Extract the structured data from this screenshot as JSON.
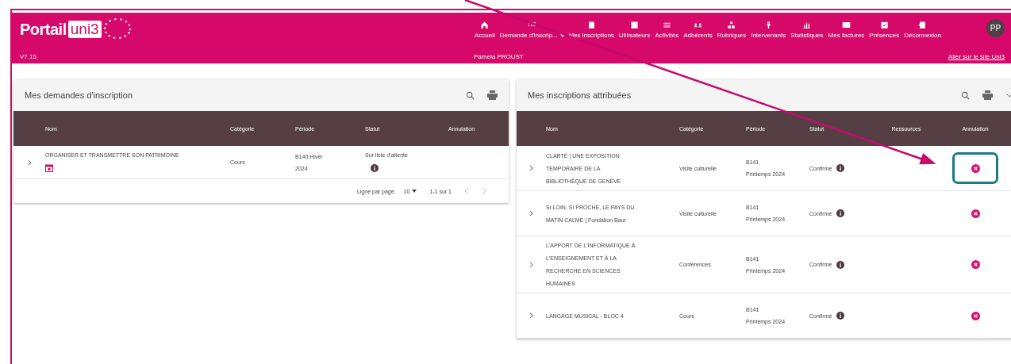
{
  "header": {
    "logo_word": "Portail",
    "logo_badge": "uni3",
    "version": "V7.15",
    "user_name": "Pamela PROUST",
    "site_link": "Aller sur le site Uni3",
    "avatar": "PP",
    "nav": [
      {
        "label": "Accueil",
        "dropdown": false
      },
      {
        "label": "Demande d'inscrip...",
        "dropdown": true
      },
      {
        "label": "Mes inscriptions",
        "dropdown": false
      },
      {
        "label": "Utilisateurs",
        "dropdown": false
      },
      {
        "label": "Activités",
        "dropdown": false
      },
      {
        "label": "Adhérents",
        "dropdown": false
      },
      {
        "label": "Rubriques",
        "dropdown": false
      },
      {
        "label": "Intervenants",
        "dropdown": false
      },
      {
        "label": "Statistiques",
        "dropdown": false
      },
      {
        "label": "Mes factures",
        "dropdown": false
      },
      {
        "label": "Présences",
        "dropdown": false
      },
      {
        "label": "Déconnexion",
        "dropdown": false
      }
    ]
  },
  "requests": {
    "title": "Mes demandes d'inscription",
    "columns": [
      "Nom",
      "Catégorie",
      "Période",
      "Statut",
      "Annulation"
    ],
    "rows": [
      {
        "name": "ORGANISER ET TRANSMETTRE SON PATRIMOINE",
        "category": "Cours",
        "period": [
          "B140 Hiver",
          "2024"
        ],
        "status": "Sur liste d'attente"
      }
    ],
    "footer": {
      "rows_label": "Ligne par page:",
      "rows_value": "10",
      "range": "1-1 sur 1"
    }
  },
  "attributed": {
    "title": "Mes inscriptions attribuées",
    "columns": [
      "Nom",
      "Catégorie",
      "Période",
      "Statut",
      "Ressources",
      "Annulation"
    ],
    "rows": [
      {
        "name": [
          "CLARTÉ | UNE EXPOSITION",
          "TEMPORAIRE DE LA",
          "BIBLIOTHÈQUE DE GENÈVE"
        ],
        "category": "Visite culturelle",
        "period": [
          "B141",
          "Printemps 2024"
        ],
        "status": "Confirmé",
        "highlighted": true
      },
      {
        "name": [
          "SI LOIN, SI PROCHE, LE PAYS DU",
          "MATIN CALME | Fondation Baur"
        ],
        "category": "Visite culturelle",
        "period": [
          "B141",
          "Printemps 2024"
        ],
        "status": "Confirmé",
        "highlighted": false
      },
      {
        "name": [
          "L'APPORT DE L'INFORMATIQUE À",
          "L'ENSEIGNEMENT ET À LA",
          "RECHERCHE EN SCIENCES",
          "HUMAINES"
        ],
        "category": "Conférences",
        "period": [
          "B141",
          "Printemps 2024"
        ],
        "status": "Confirmé",
        "highlighted": false
      },
      {
        "name": [
          "LANGAGE MUSICAL - BLOC 4"
        ],
        "category": "Cours",
        "period": [
          "B141",
          "Printemps 2024"
        ],
        "status": "Confirmé",
        "highlighted": false
      }
    ]
  }
}
